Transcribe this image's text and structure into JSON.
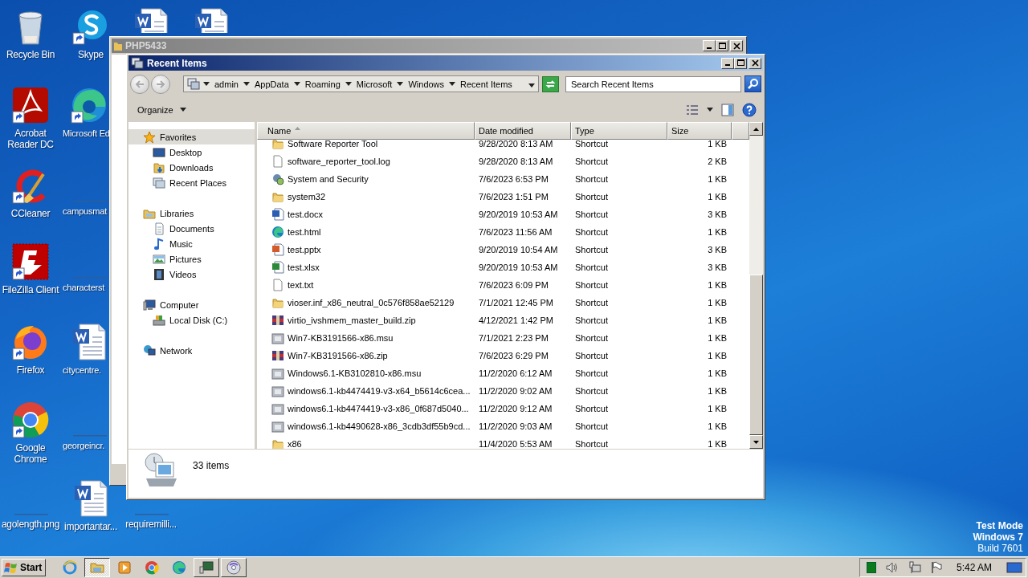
{
  "desktop": {
    "icons": [
      {
        "label": "Recycle Bin",
        "kind": "recycle-bin",
        "shortcut": false
      },
      {
        "label": "Skype",
        "kind": "skype",
        "shortcut": true
      },
      {
        "kind": "word",
        "shortcut": false
      },
      {
        "kind": "word",
        "shortcut": false
      },
      {
        "label": "Acrobat Reader DC",
        "kind": "acrobat",
        "shortcut": true
      },
      {
        "label": "Microsoft Ed",
        "kind": "edge",
        "shortcut": true
      },
      {
        "label": "CCleaner",
        "kind": "ccleaner",
        "shortcut": true
      },
      {
        "label": "campusmat",
        "kind": "blank",
        "shortcut": false
      },
      {
        "label": "FileZilla Client",
        "kind": "filezilla",
        "shortcut": true
      },
      {
        "label": "characterst",
        "kind": "blank",
        "shortcut": false
      },
      {
        "label": "Firefox",
        "kind": "firefox",
        "shortcut": true
      },
      {
        "label": "citycentre.",
        "kind": "word",
        "shortcut": false
      },
      {
        "label": "Google Chrome",
        "kind": "chrome",
        "shortcut": true
      },
      {
        "label": "georgeincr.",
        "kind": "blank",
        "shortcut": false
      },
      {
        "label": "agolength.png",
        "kind": "blank",
        "shortcut": false
      },
      {
        "label": "importantar...",
        "kind": "word",
        "shortcut": false
      },
      {
        "label": "requiremilli...",
        "kind": "blank",
        "shortcut": false
      }
    ]
  },
  "background_window": {
    "title": "PHP5433"
  },
  "explorer": {
    "title": "Recent Items",
    "breadcrumb": [
      "admin",
      "AppData",
      "Roaming",
      "Microsoft",
      "Windows",
      "Recent Items"
    ],
    "search": {
      "placeholder": "Search Recent Items"
    },
    "organize": "Organize",
    "sidebar": [
      {
        "label": "Favorites",
        "kind": "favorites",
        "selected": true,
        "children": [
          {
            "label": "Desktop",
            "kind": "desktop",
            "selected": false
          },
          {
            "label": "Downloads",
            "kind": "downloads",
            "selected": false
          },
          {
            "label": "Recent Places",
            "kind": "recent",
            "selected": false
          }
        ]
      },
      {
        "label": "Libraries",
        "kind": "libraries",
        "selected": false,
        "children": [
          {
            "label": "Documents",
            "kind": "documents",
            "selected": false
          },
          {
            "label": "Music",
            "kind": "music",
            "selected": false
          },
          {
            "label": "Pictures",
            "kind": "pictures",
            "selected": false
          },
          {
            "label": "Videos",
            "kind": "videos",
            "selected": false
          }
        ]
      },
      {
        "label": "Computer",
        "kind": "computer",
        "selected": false,
        "children": [
          {
            "label": "Local Disk (C:)",
            "kind": "disk",
            "selected": false
          }
        ]
      },
      {
        "label": "Network",
        "kind": "network",
        "selected": false
      }
    ],
    "columns": [
      {
        "label": "Name",
        "sorted": true
      },
      {
        "label": "Date modified",
        "sorted": false
      },
      {
        "label": "Type",
        "sorted": false
      },
      {
        "label": "Size",
        "sorted": false
      }
    ],
    "rows": [
      {
        "name": "Software Reporter Tool",
        "date": "9/28/2020 8:13 AM",
        "type": "Shortcut",
        "size": "1 KB",
        "kind": "folder"
      },
      {
        "name": "software_reporter_tool.log",
        "date": "9/28/2020 8:13 AM",
        "type": "Shortcut",
        "size": "2 KB",
        "kind": "file"
      },
      {
        "name": "System and Security",
        "date": "7/6/2023 6:53 PM",
        "type": "Shortcut",
        "size": "1 KB",
        "kind": "control-panel"
      },
      {
        "name": "system32",
        "date": "7/6/2023 1:51 PM",
        "type": "Shortcut",
        "size": "1 KB",
        "kind": "folder"
      },
      {
        "name": "test.docx",
        "date": "9/20/2019 10:53 AM",
        "type": "Shortcut",
        "size": "3 KB",
        "kind": "word"
      },
      {
        "name": "test.html",
        "date": "7/6/2023 11:56 AM",
        "type": "Shortcut",
        "size": "1 KB",
        "kind": "edge"
      },
      {
        "name": "test.pptx",
        "date": "9/20/2019 10:54 AM",
        "type": "Shortcut",
        "size": "3 KB",
        "kind": "powerpoint"
      },
      {
        "name": "test.xlsx",
        "date": "9/20/2019 10:53 AM",
        "type": "Shortcut",
        "size": "3 KB",
        "kind": "excel"
      },
      {
        "name": "text.txt",
        "date": "7/6/2023 6:09 PM",
        "type": "Shortcut",
        "size": "1 KB",
        "kind": "file"
      },
      {
        "name": "vioser.inf_x86_neutral_0c576f858ae52129",
        "date": "7/1/2021 12:45 PM",
        "type": "Shortcut",
        "size": "1 KB",
        "kind": "folder"
      },
      {
        "name": "virtio_ivshmem_master_build.zip",
        "date": "4/12/2021 1:42 PM",
        "type": "Shortcut",
        "size": "1 KB",
        "kind": "archive"
      },
      {
        "name": "Win7-KB3191566-x86.msu",
        "date": "7/1/2021 2:23 PM",
        "type": "Shortcut",
        "size": "1 KB",
        "kind": "package"
      },
      {
        "name": "Win7-KB3191566-x86.zip",
        "date": "7/6/2023 6:29 PM",
        "type": "Shortcut",
        "size": "1 KB",
        "kind": "archive"
      },
      {
        "name": "Windows6.1-KB3102810-x86.msu",
        "date": "11/2/2020 6:12 AM",
        "type": "Shortcut",
        "size": "1 KB",
        "kind": "package"
      },
      {
        "name": "windows6.1-kb4474419-v3-x64_b5614c6cea...",
        "date": "11/2/2020 9:02 AM",
        "type": "Shortcut",
        "size": "1 KB",
        "kind": "package"
      },
      {
        "name": "windows6.1-kb4474419-v3-x86_0f687d5040...",
        "date": "11/2/2020 9:12 AM",
        "type": "Shortcut",
        "size": "1 KB",
        "kind": "package"
      },
      {
        "name": "windows6.1-kb4490628-x86_3cdb3df55b9cd...",
        "date": "11/2/2020 9:03 AM",
        "type": "Shortcut",
        "size": "1 KB",
        "kind": "package"
      },
      {
        "name": "x86",
        "date": "11/4/2020 5:53 AM",
        "type": "Shortcut",
        "size": "1 KB",
        "kind": "folder"
      }
    ],
    "status": "33 items"
  },
  "os_notice": [
    "Test Mode",
    "Windows 7",
    "Build 7601"
  ],
  "taskbar": {
    "start": "Start",
    "items": [
      {
        "kind": "ie",
        "running": false,
        "active": false
      },
      {
        "kind": "explorer",
        "running": true,
        "active": true
      },
      {
        "kind": "media-player",
        "running": false,
        "active": false
      },
      {
        "kind": "chrome",
        "running": false,
        "active": false
      },
      {
        "kind": "edge",
        "running": false,
        "active": false
      },
      {
        "kind": "monitor-app",
        "running": true,
        "active": false
      },
      {
        "kind": "disc",
        "running": true,
        "active": false
      }
    ],
    "clock": "5:42 AM"
  }
}
